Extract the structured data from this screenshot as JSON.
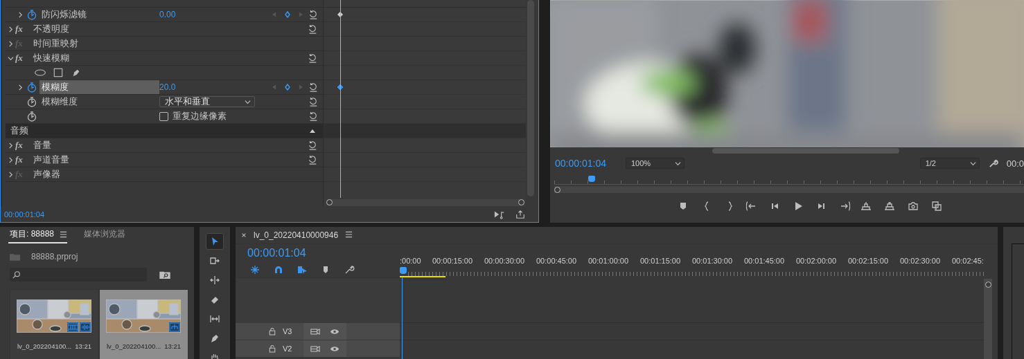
{
  "effect_controls": {
    "rows": [
      {
        "kind": "property",
        "label": "防闪烁滤镜",
        "value": "0.00",
        "expandable": true,
        "animated": true,
        "selected": false,
        "keyframe": true
      },
      {
        "kind": "effect",
        "fx": "fx",
        "label": "不透明度",
        "expanded": false,
        "fx_on": true,
        "reset": true
      },
      {
        "kind": "effect",
        "fx": "fx",
        "label": "时间重映射",
        "expanded": false,
        "fx_on": false,
        "reset": false
      },
      {
        "kind": "effect",
        "fx": "fx",
        "label": "快速模糊",
        "expanded": true,
        "fx_on": true,
        "reset": true
      },
      {
        "kind": "mask_tools"
      },
      {
        "kind": "property",
        "label": "模糊度",
        "value": "20.0",
        "expandable": true,
        "animated": true,
        "selected": true,
        "keyframe": true
      },
      {
        "kind": "dropdown",
        "label": "模糊维度",
        "value": "水平和垂直",
        "animated": false
      },
      {
        "kind": "checkbox",
        "label": "重复边缘像素",
        "checked": false,
        "animated": false
      },
      {
        "kind": "section",
        "label": "音频",
        "expanded": true
      },
      {
        "kind": "effect",
        "fx": "fx",
        "label": "音量",
        "expanded": false,
        "fx_on": true,
        "reset": true
      },
      {
        "kind": "effect",
        "fx": "fx",
        "label": "声道音量",
        "expanded": false,
        "fx_on": true,
        "reset": true
      },
      {
        "kind": "effect",
        "fx": "fx",
        "label": "声像器",
        "expanded": false,
        "fx_on": false,
        "reset": false
      }
    ],
    "timecode": "00:00:01:04"
  },
  "program_monitor": {
    "timecode": "00:00:01:04",
    "zoom": "100%",
    "resolution": "1/2",
    "duration": "00:0",
    "playhead": {
      "level": 0.08
    }
  },
  "project": {
    "tabs": [
      {
        "label": "项目: 88888",
        "selected": true
      },
      {
        "label": "媒体浏览器",
        "selected": false
      }
    ],
    "file": "88888.prproj",
    "clips": [
      {
        "name": "lv_0_202204100...",
        "duration": "13:21",
        "kind": "video",
        "selected": false
      },
      {
        "name": "lv_0_202204100...",
        "duration": "13:21",
        "kind": "sequence",
        "selected": true
      }
    ]
  },
  "tools": [
    {
      "kind": "selection",
      "selected": true
    },
    {
      "kind": "track_select",
      "selected": false
    },
    {
      "kind": "ripple",
      "selected": false
    },
    {
      "kind": "razor",
      "selected": false
    },
    {
      "kind": "slip",
      "selected": false
    },
    {
      "kind": "pen",
      "selected": false
    },
    {
      "kind": "hand",
      "selected": false
    }
  ],
  "timeline": {
    "tab": "lv_0_20220410000946",
    "timecode": "00:00:01:04",
    "ruler": [
      ":00:00",
      "00:00:15:00",
      "00:00:30:00",
      "00:00:45:00",
      "00:01:00:00",
      "00:01:15:00",
      "00:01:30:00",
      "00:01:45:00",
      "00:02:00:00",
      "00:02:15:00",
      "00:02:30:00",
      "00:02:45:"
    ],
    "tracks": [
      {
        "name": "V3"
      },
      {
        "name": "V2"
      }
    ]
  }
}
